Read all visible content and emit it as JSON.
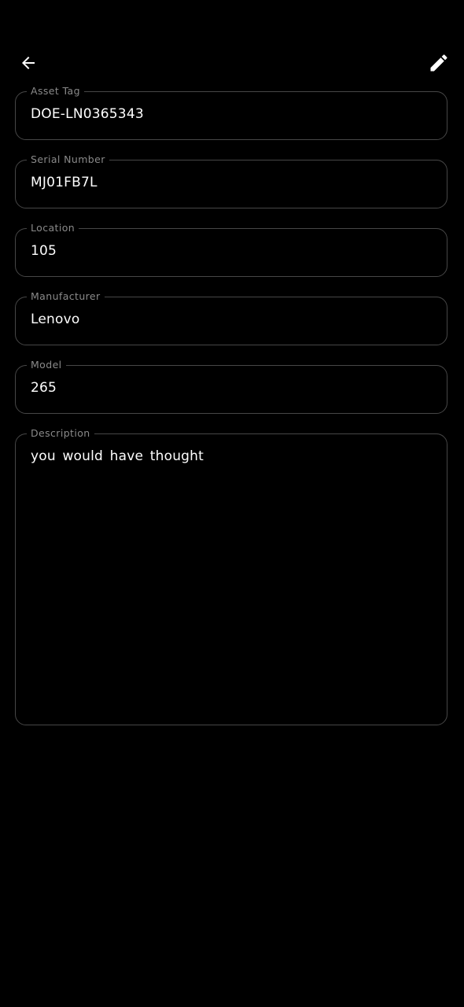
{
  "header": {
    "back_icon": "arrow-left-icon",
    "edit_icon": "pencil-icon",
    "icon_color": "#ffffff"
  },
  "fields": {
    "asset_tag": {
      "label": "Asset Tag",
      "value": "DOE-LN0365343"
    },
    "serial_number": {
      "label": "Serial Number",
      "value": "MJ01FB7L"
    },
    "location": {
      "label": "Location",
      "value": "105"
    },
    "manufacturer": {
      "label": "Manufacturer",
      "value": "Lenovo"
    },
    "model": {
      "label": "Model",
      "value": "265"
    },
    "description": {
      "label": "Description",
      "value": "you would have thought"
    }
  },
  "theme": {
    "background": "#000000",
    "border": "#474747",
    "label_color": "#8a8a8a",
    "text_color": "#ffffff"
  }
}
